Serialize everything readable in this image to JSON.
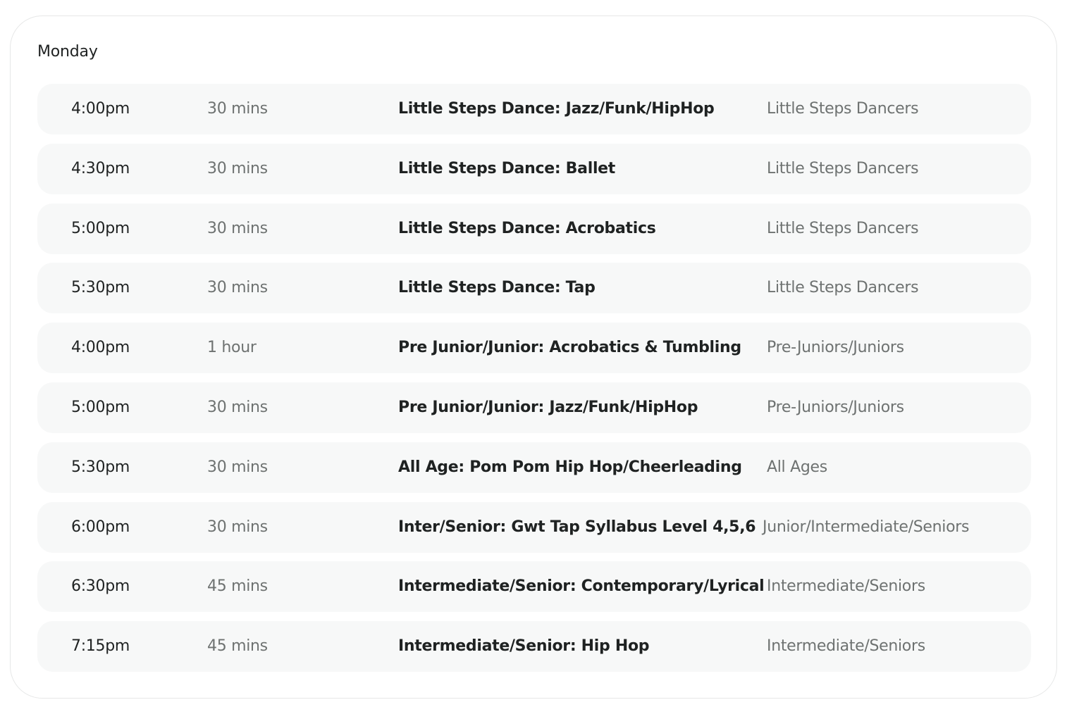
{
  "day": "Monday",
  "classes": [
    {
      "time": "4:00pm",
      "duration": "30 mins",
      "name": "Little Steps Dance: Jazz/Funk/HipHop",
      "group": "Little Steps Dancers"
    },
    {
      "time": "4:30pm",
      "duration": "30 mins",
      "name": "Little Steps Dance: Ballet",
      "group": "Little Steps Dancers"
    },
    {
      "time": "5:00pm",
      "duration": "30 mins",
      "name": "Little Steps Dance: Acrobatics",
      "group": "Little Steps Dancers"
    },
    {
      "time": "5:30pm",
      "duration": "30 mins",
      "name": "Little Steps Dance: Tap",
      "group": "Little Steps Dancers"
    },
    {
      "time": "4:00pm",
      "duration": "1 hour",
      "name": "Pre Junior/Junior: Acrobatics & Tumbling",
      "group": "Pre-Juniors/Juniors"
    },
    {
      "time": "5:00pm",
      "duration": "30 mins",
      "name": "Pre Junior/Junior: Jazz/Funk/HipHop",
      "group": "Pre-Juniors/Juniors"
    },
    {
      "time": "5:30pm",
      "duration": "30 mins",
      "name": "All Age: Pom Pom Hip Hop/Cheerleading",
      "group": "All Ages"
    },
    {
      "time": "6:00pm",
      "duration": "30 mins",
      "name": "Inter/Senior: Gwt Tap Syllabus Level 4,5,6",
      "group": "Junior/Intermediate/Seniors"
    },
    {
      "time": "6:30pm",
      "duration": "45 mins",
      "name": "Intermediate/Senior: Contemporary/Lyrical",
      "group": "Intermediate/Seniors"
    },
    {
      "time": "7:15pm",
      "duration": "45 mins",
      "name": "Intermediate/Senior: Hip Hop",
      "group": "Intermediate/Seniors"
    }
  ]
}
